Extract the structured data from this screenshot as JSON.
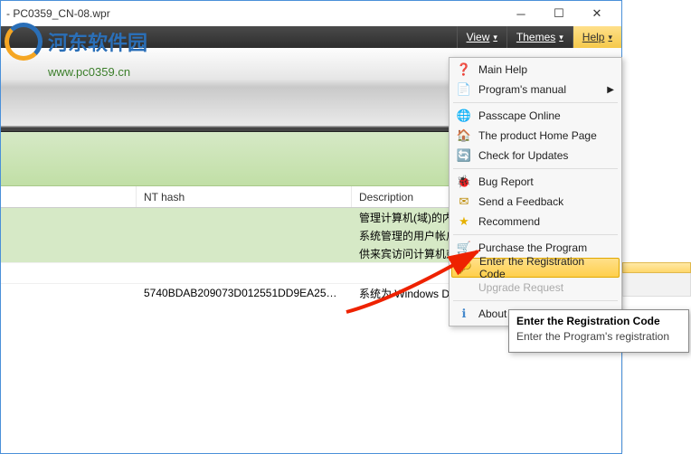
{
  "titlebar": {
    "title": "- PC0359_CN-08.wpr"
  },
  "watermark": {
    "site_name": "河东软件园",
    "url": "www.pc0359.cn"
  },
  "menubar": {
    "view": "View",
    "themes": "Themes",
    "help": "Help"
  },
  "table": {
    "headers": {
      "nt_hash": "NT hash",
      "description": "Description"
    },
    "rows": [
      {
        "hash": "",
        "desc": "管理计算机(域)的内置",
        "green": true
      },
      {
        "hash": "",
        "desc": "系统管理的用户帐户",
        "green": true
      },
      {
        "hash": "",
        "desc": "供来宾访问计算机或",
        "green": true
      }
    ],
    "data_row": {
      "hash": "5740BDAB209073D012551DD9EA25…",
      "desc": "系统为 Windows D"
    }
  },
  "help_menu": {
    "items": [
      {
        "id": "main-help",
        "label": "Main Help",
        "icon": "❓",
        "color": "#d33"
      },
      {
        "id": "programs-manual",
        "label": "Program's manual",
        "icon": "📄",
        "submenu": true
      },
      {
        "sep": true
      },
      {
        "id": "passcape-online",
        "label": "Passcape Online",
        "icon": "🌐",
        "color": "#2a8"
      },
      {
        "id": "product-home",
        "label": "The product Home Page",
        "icon": "🏠",
        "color": "#2a8"
      },
      {
        "id": "check-updates",
        "label": "Check for Updates",
        "icon": "🔄",
        "color": "#2a8"
      },
      {
        "sep": true
      },
      {
        "id": "bug-report",
        "label": "Bug Report",
        "icon": "🐞",
        "color": "#b80"
      },
      {
        "id": "send-feedback",
        "label": "Send a Feedback",
        "icon": "✉",
        "color": "#b80"
      },
      {
        "id": "recommend",
        "label": "Recommend",
        "icon": "★",
        "color": "#e6b100"
      },
      {
        "sep": true
      },
      {
        "id": "purchase",
        "label": "Purchase the Program",
        "icon": "🛒",
        "color": "#7a4"
      },
      {
        "id": "enter-reg",
        "label": "Enter the Registration Code",
        "icon": "🔑",
        "color": "#e6b100",
        "highlight": true
      },
      {
        "id": "upgrade",
        "label": "Upgrade Request",
        "icon": "",
        "disabled": true
      },
      {
        "sep": true
      },
      {
        "id": "about",
        "label": "About",
        "icon": "ℹ",
        "color": "#48c"
      }
    ]
  },
  "tooltip": {
    "title": "Enter the Registration Code",
    "body": "Enter the Program's registration"
  }
}
